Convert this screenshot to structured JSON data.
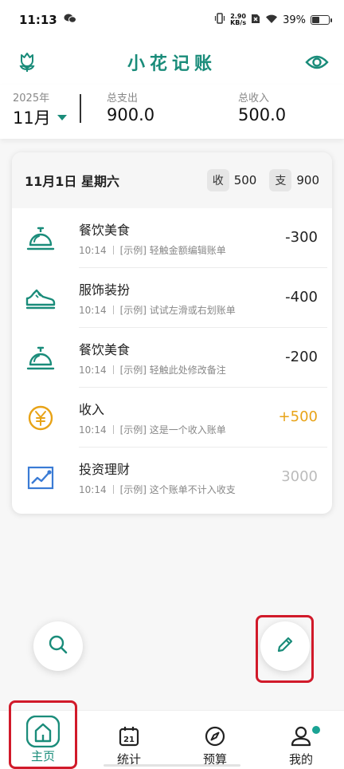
{
  "status_bar": {
    "time": "11:13",
    "net_speed_value": "2.90",
    "net_speed_unit": "KB/s",
    "battery": "39%",
    "battery_level": 0.39
  },
  "header": {
    "title": "小花记账",
    "left_icon": "flower-icon",
    "right_icon": "eye-icon"
  },
  "summary": {
    "year": "2025年",
    "month": "11月",
    "expense_label": "总支出",
    "expense_value": "900.0",
    "income_label": "总收入",
    "income_value": "500.0"
  },
  "day_card": {
    "date": "11月1日  星期六",
    "income_key": "收",
    "income_value": "500",
    "expense_key": "支",
    "expense_value": "900",
    "transactions": [
      {
        "name": "餐饮美食",
        "time": "10:14",
        "note": "[示例] 轻触金额编辑账单",
        "amount": "-300",
        "icon": "dining-bell-icon"
      },
      {
        "name": "服饰装扮",
        "time": "10:14",
        "note": "[示例] 试试左滑或右划账单",
        "amount": "-400",
        "icon": "sneaker-icon"
      },
      {
        "name": "餐饮美食",
        "time": "10:14",
        "note": "[示例] 轻触此处修改备注",
        "amount": "-200",
        "icon": "dining-bell-icon"
      },
      {
        "name": "收入",
        "time": "10:14",
        "note": "[示例] 这是一个收入账单",
        "amount": "+500",
        "icon": "yen-coin-icon"
      },
      {
        "name": "投资理财",
        "time": "10:14",
        "note": "[示例] 这个账单不计入收支",
        "amount": "3000",
        "icon": "investment-chart-icon"
      }
    ]
  },
  "nav": {
    "home": "主页",
    "stats": "统计",
    "budget": "预算",
    "mine": "我的",
    "calendar_day": "21"
  },
  "colors": {
    "accent": "#1a8c7a",
    "income": "#e8a317",
    "neutral_amount": "#bbbbbb",
    "highlight": "#d11a2a"
  }
}
